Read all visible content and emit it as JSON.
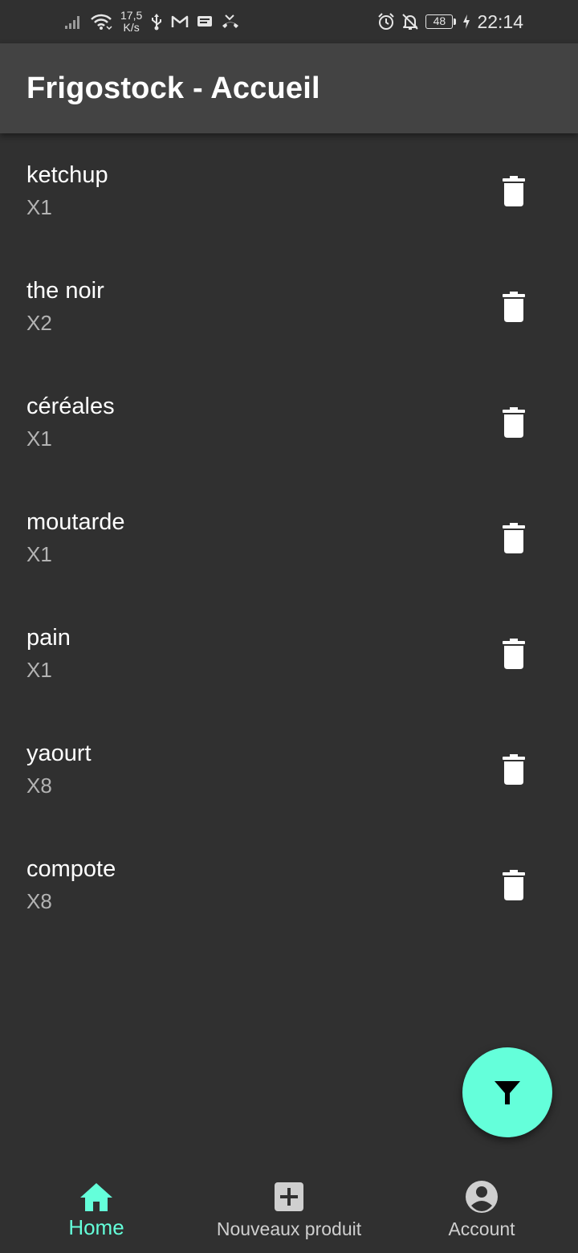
{
  "status_bar": {
    "net_speed_value": "17,5",
    "net_speed_unit": "K/s",
    "battery": "48",
    "time": "22:14",
    "icons": [
      "signal-icon",
      "wifi-icon",
      "usb-icon",
      "gmail-icon",
      "message-icon",
      "missed-call-icon",
      "alarm-icon",
      "notifications-off-icon",
      "battery-icon",
      "charging-icon"
    ]
  },
  "app_bar": {
    "title": "Frigostock - Accueil"
  },
  "products": [
    {
      "name": "ketchup",
      "qty": "X1"
    },
    {
      "name": "the noir",
      "qty": "X2"
    },
    {
      "name": "céréales",
      "qty": "X1"
    },
    {
      "name": "moutarde",
      "qty": "X1"
    },
    {
      "name": "pain",
      "qty": "X1"
    },
    {
      "name": "yaourt",
      "qty": "X8"
    },
    {
      "name": "compote",
      "qty": "X8"
    }
  ],
  "item_action_icon": "trash-icon",
  "fab": {
    "icon": "filter-icon"
  },
  "bottom_nav": {
    "items": [
      {
        "label": "Home",
        "icon": "home-icon",
        "active": true
      },
      {
        "label": "Nouveaux produit",
        "icon": "add-box-icon",
        "active": false
      },
      {
        "label": "Account",
        "icon": "account-circle-icon",
        "active": false
      }
    ]
  },
  "colors": {
    "background": "#303030",
    "app_bar": "#434343",
    "accent": "#64ffda",
    "secondary_text": "#b3b3b3"
  }
}
